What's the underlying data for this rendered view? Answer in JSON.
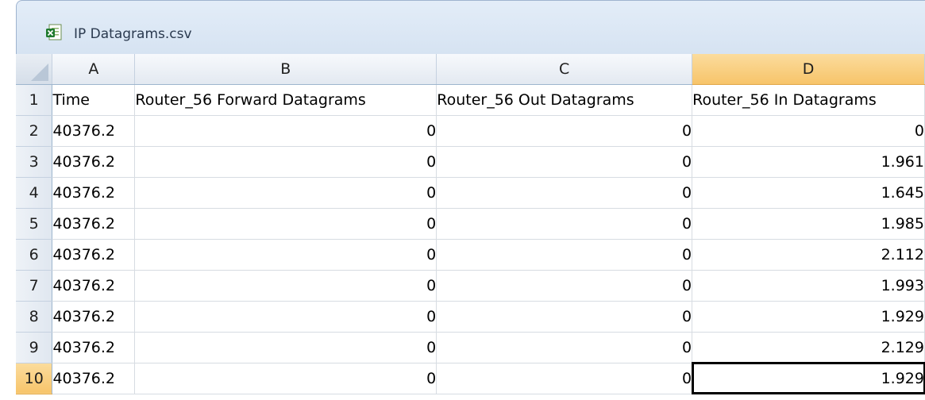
{
  "window": {
    "title": "IP Datagrams.csv",
    "icon": "excel-file-icon"
  },
  "columns": [
    "A",
    "B",
    "C",
    "D"
  ],
  "selected_column": "D",
  "active_cell": "D10",
  "rows": [
    {
      "num": "1",
      "cells": [
        "Time",
        "Router_56 Forward Datagrams",
        "Router_56 Out Datagrams",
        "Router_56 In Datagrams"
      ]
    },
    {
      "num": "2",
      "cells": [
        "40376.2",
        "0",
        "0",
        "0"
      ]
    },
    {
      "num": "3",
      "cells": [
        "40376.2",
        "0",
        "0",
        "1.961"
      ]
    },
    {
      "num": "4",
      "cells": [
        "40376.2",
        "0",
        "0",
        "1.645"
      ]
    },
    {
      "num": "5",
      "cells": [
        "40376.2",
        "0",
        "0",
        "1.985"
      ]
    },
    {
      "num": "6",
      "cells": [
        "40376.2",
        "0",
        "0",
        "2.112"
      ]
    },
    {
      "num": "7",
      "cells": [
        "40376.2",
        "0",
        "0",
        "1.993"
      ]
    },
    {
      "num": "8",
      "cells": [
        "40376.2",
        "0",
        "0",
        "1.929"
      ]
    },
    {
      "num": "9",
      "cells": [
        "40376.2",
        "0",
        "0",
        "2.129"
      ]
    },
    {
      "num": "10",
      "cells": [
        "40376.2",
        "0",
        "0",
        "1.929"
      ]
    }
  ],
  "colors": {
    "selected_header": "#f7c46a",
    "header_bg": "#e3e9f1",
    "gridline": "#d7dce2"
  }
}
